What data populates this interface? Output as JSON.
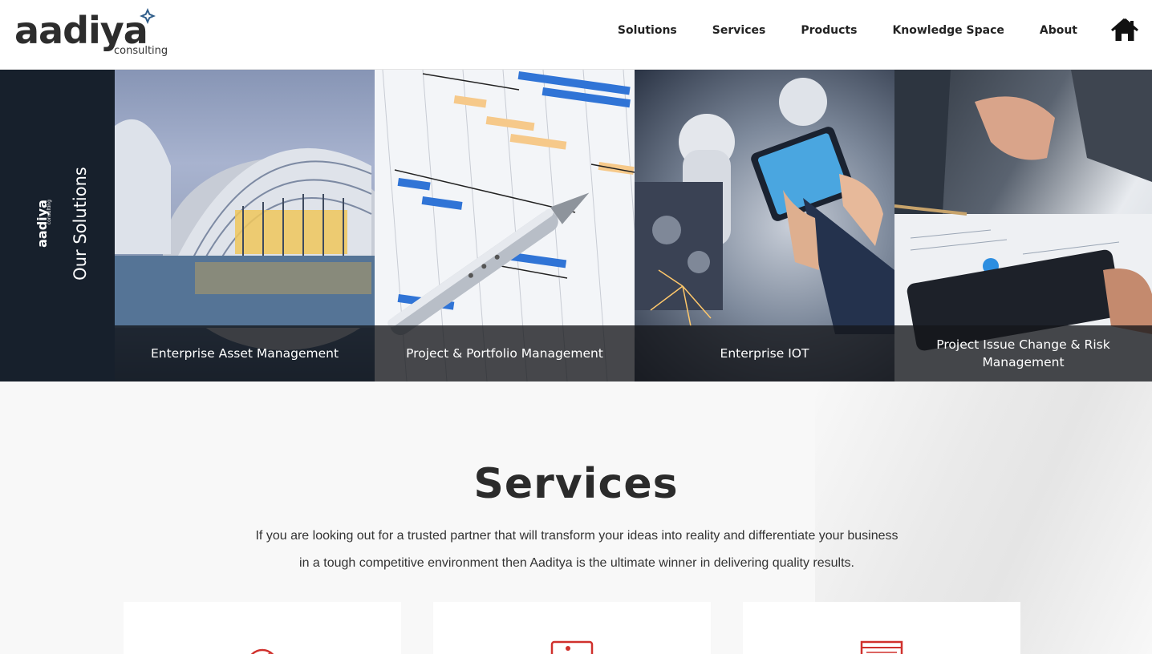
{
  "brand": {
    "name": "aadiya",
    "sub": "consulting",
    "accent": "#2f5d8a"
  },
  "nav": {
    "items": [
      {
        "label": "Solutions"
      },
      {
        "label": "Services"
      },
      {
        "label": "Products"
      },
      {
        "label": "Knowledge Space"
      },
      {
        "label": "About"
      }
    ],
    "home_icon": "home-icon"
  },
  "solutions": {
    "side_title": "Our Solutions",
    "side_logo": "aadiya",
    "side_logo_sub": "consulting",
    "cards": [
      {
        "label": "Enterprise Asset Management"
      },
      {
        "label": "Project & Portfolio Management"
      },
      {
        "label": "Enterprise IOT"
      },
      {
        "label": "Project Issue Change & Risk Management"
      }
    ]
  },
  "services": {
    "title": "Services",
    "description_line1": "If you are looking out for a trusted partner that will transform your ideas into reality and differentiate your business",
    "description_line2": "in a tough competitive environment then Aaditya is the ultimate winner in delivering quality results.",
    "icon_color": "#d0312d",
    "cards": [
      {
        "icon": "gauge-icon"
      },
      {
        "icon": "monitor-icon"
      },
      {
        "icon": "browser-window-icon"
      }
    ]
  }
}
